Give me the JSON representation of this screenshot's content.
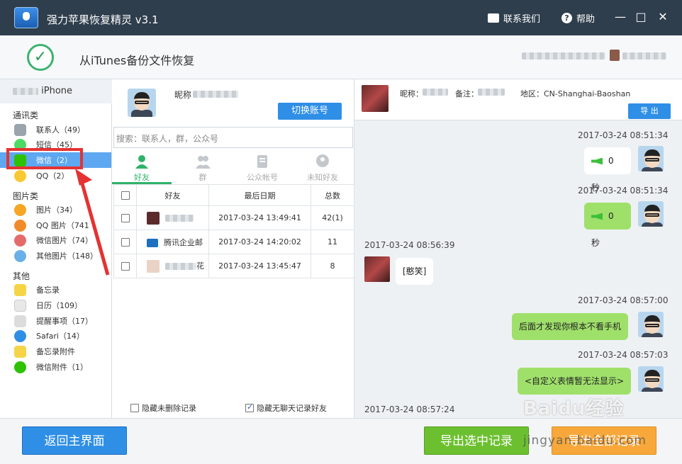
{
  "titlebar": {
    "title": "强力苹果恢复精灵 v3.1",
    "contact": "联系我们",
    "help": "帮助",
    "minimize": "—",
    "maximize": "□",
    "close": "✕"
  },
  "header": {
    "title": "从iTunes备份文件恢复"
  },
  "sidebar": {
    "device": "iPhone",
    "sections": [
      {
        "title": "通讯类",
        "items": [
          {
            "label": "联系人（49）",
            "icon": "contacts-icon",
            "color": "#9aa4ad"
          },
          {
            "label": "短信（45）",
            "icon": "sms-icon",
            "color": "#4cd964"
          },
          {
            "label": "微信（2）",
            "icon": "wechat-icon",
            "color": "#2dc100",
            "active": true
          },
          {
            "label": "QQ（2）",
            "icon": "qq-icon",
            "color": "#f9c934"
          }
        ]
      },
      {
        "title": "图片类",
        "items": [
          {
            "label": "图片（34）",
            "icon": "photos-icon",
            "color": "#f5a623"
          },
          {
            "label": "QQ 图片（741",
            "icon": "qq-photos-icon",
            "color": "#f08b2a"
          },
          {
            "label": "微信图片（74）",
            "icon": "wechat-photos-icon",
            "color": "#e56b6b"
          },
          {
            "label": "其他图片（148）",
            "icon": "other-photos-icon",
            "color": "#6ab0e8"
          }
        ]
      },
      {
        "title": "其他",
        "items": [
          {
            "label": "备忘录",
            "icon": "notes-icon",
            "color": "#f5d547"
          },
          {
            "label": "日历（109）",
            "icon": "calendar-icon",
            "color": "#e8e8e8"
          },
          {
            "label": "提醒事项（17）",
            "icon": "reminders-icon",
            "color": "#dcdcdc"
          },
          {
            "label": "Safari（14）",
            "icon": "safari-icon",
            "color": "#2f8fe6"
          },
          {
            "label": "备忘录附件",
            "icon": "notes-attach-icon",
            "color": "#f5d547"
          },
          {
            "label": "微信附件（1）",
            "icon": "wechat-attach-icon",
            "color": "#2dc100"
          }
        ]
      }
    ]
  },
  "account": {
    "nickname_label": "昵称",
    "switch_label": "切换账号"
  },
  "search": {
    "placeholder": "搜索：联系人，群，公众号"
  },
  "tabs": [
    {
      "label": "好友",
      "active": true
    },
    {
      "label": "群"
    },
    {
      "label": "公众帐号"
    },
    {
      "label": "未知好友"
    }
  ],
  "table": {
    "headers": [
      "好友",
      "最后日期",
      "总数"
    ],
    "rows": [
      {
        "name": "",
        "date": "2017-03-24 13:49:41",
        "count": "42(1)"
      },
      {
        "name": "腾讯企业邮",
        "date": "2017-03-24 14:20:02",
        "count": "11"
      },
      {
        "name": "花",
        "date": "2017-03-24 13:45:47",
        "count": "8"
      }
    ]
  },
  "options": {
    "hide_undeleted": "隐藏未删除记录",
    "hide_no_chat": "隐藏无聊天记录好友"
  },
  "chat": {
    "nickname_label": "昵称：",
    "remark_label": "备注：",
    "region": "地区：CN-Shanghai-Baoshan",
    "export_label": "导 出",
    "messages": [
      {
        "time": "2017-03-24 08:51:34",
        "text": "0 秒",
        "voice": true
      },
      {
        "time": "2017-03-24 08:51:34",
        "text": "0 秒",
        "voice": true
      },
      {
        "time": "2017-03-24 08:56:39",
        "text": "[憨笑]"
      },
      {
        "time": "2017-03-24 08:57:00",
        "text": "后面才发现你根本不看手机"
      },
      {
        "time": "2017-03-24 08:57:03",
        "text": "<自定义表情暂无法显示>"
      },
      {
        "time": "2017-03-24 08:57:24",
        "text": ""
      }
    ]
  },
  "footer": {
    "back": "返回主界面",
    "export_selected": "导出选中记录",
    "export_all": "导出全部记录"
  },
  "watermark": {
    "line1": "Baidu经验",
    "line2": "jingyan.baidu.com"
  }
}
